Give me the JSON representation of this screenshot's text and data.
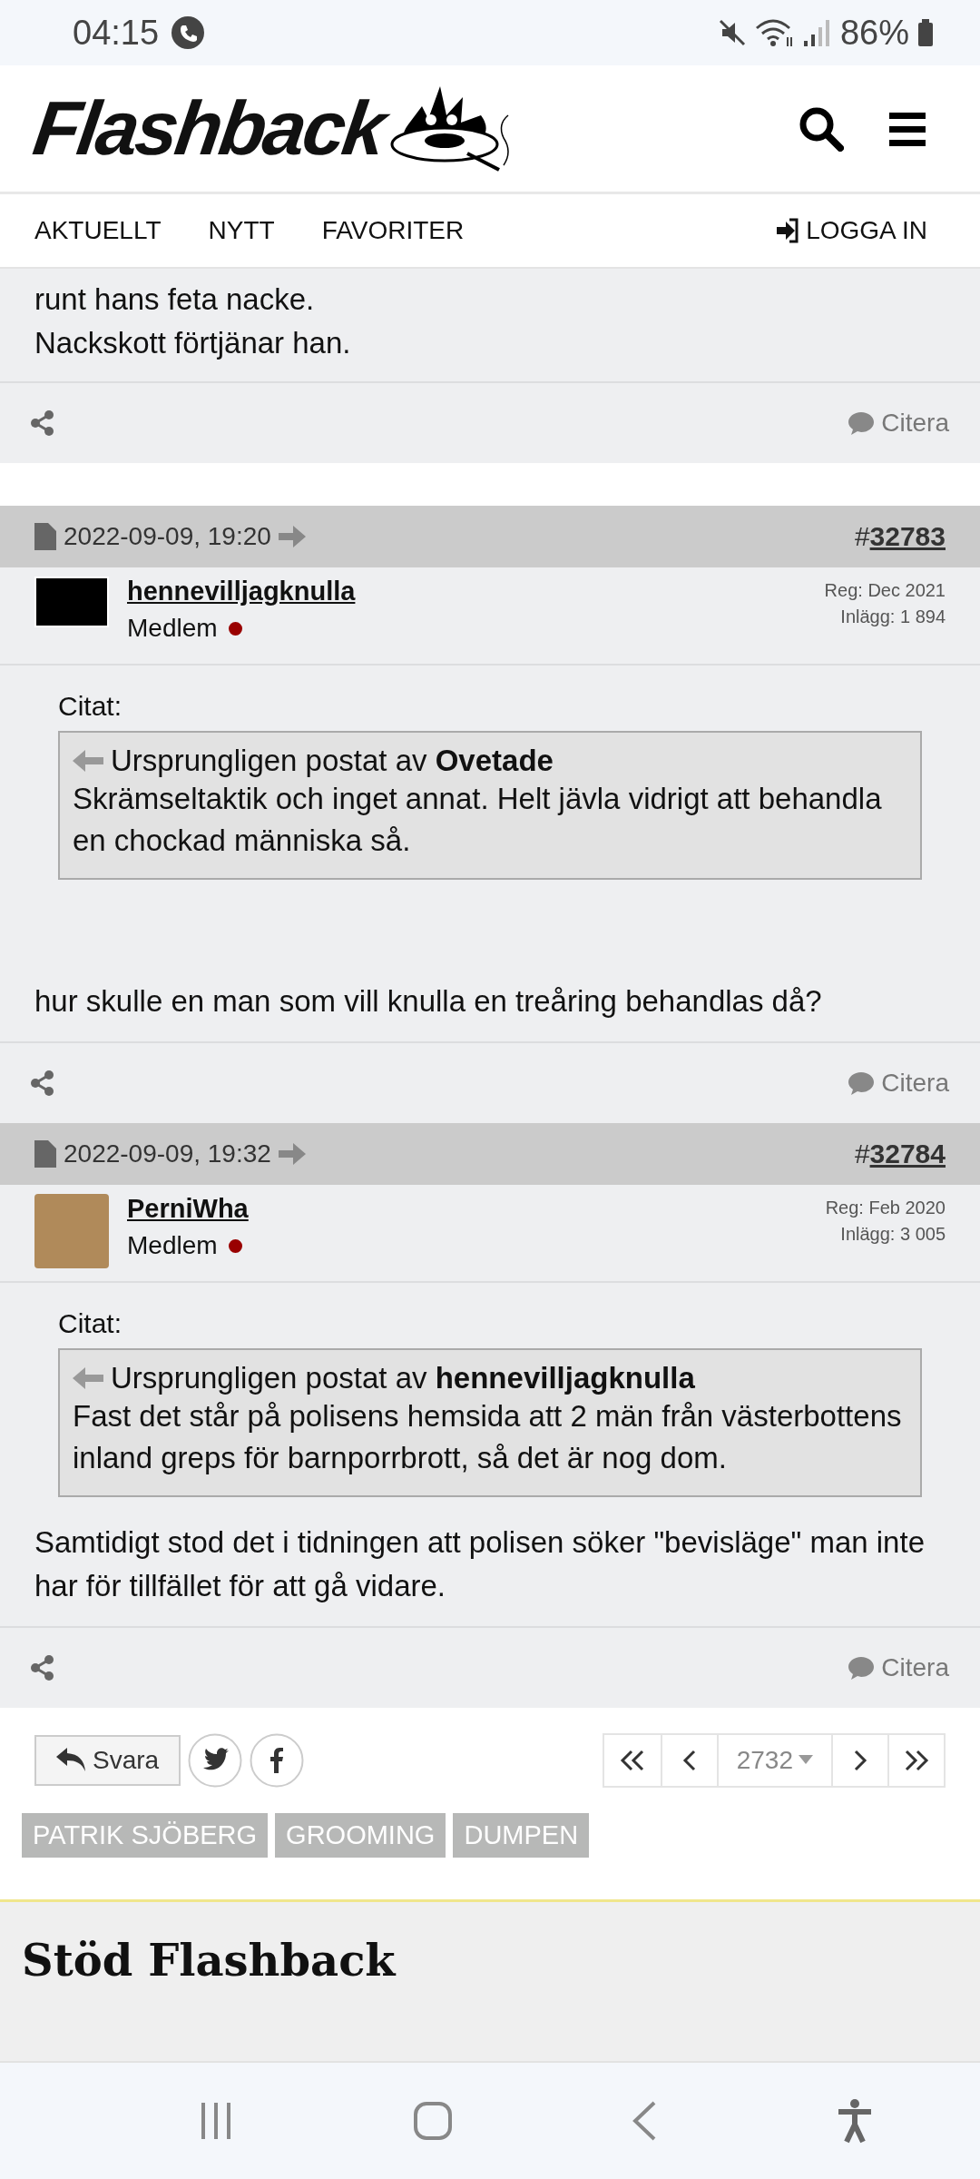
{
  "status_bar": {
    "time": "04:15",
    "battery": "86%"
  },
  "header": {
    "logo": "Flashback"
  },
  "nav": {
    "tabs": [
      {
        "label": "AKTUELLT"
      },
      {
        "label": "NYTT"
      },
      {
        "label": "FAVORITER"
      }
    ],
    "login": "LOGGA IN"
  },
  "posts": [
    {
      "kind": "partial",
      "body": [
        "runt hans feta nacke.",
        "Nackskott förtjänar han."
      ],
      "quote_action": "Citera"
    },
    {
      "kind": "full",
      "date": "2022-09-09, 19:20",
      "number_prefix": "#",
      "number": "32783",
      "user": {
        "name": "hennevilljagknulla",
        "rank": "Medlem",
        "online": false,
        "reg": "Reg: Dec 2021",
        "posts": "Inlägg: 1 894"
      },
      "quote": {
        "label": "Citat:",
        "intro": "Ursprungligen postat av **Ovetade**",
        "text": "Skrämseltaktik och inget annat. Helt jävla vidrigt att behandla en chockad människa så."
      },
      "body": [
        "hur skulle en man som vill knulla en treåring behandlas då?"
      ],
      "quote_action": "Citera"
    },
    {
      "kind": "full",
      "date": "2022-09-09, 19:32",
      "number_prefix": "#",
      "number": "32784",
      "user": {
        "name": "PerniWha",
        "rank": "Medlem",
        "online": false,
        "reg": "Reg: Feb 2020",
        "posts": "Inlägg: 3 005"
      },
      "quote": {
        "label": "Citat:",
        "intro": "Ursprungligen postat av **hennevilljagknulla**",
        "text": "Fast det står på polisens hemsida att 2 män från västerbottens inland greps för barnporrbrott, så det är nog dom."
      },
      "body": [
        "Samtidigt stod det i tidningen att polisen söker \"bevisläge\" man inte har för tillfället för att gå vidare."
      ],
      "quote_action": "Citera"
    }
  ],
  "reply_button": "Svara",
  "pagination": {
    "page": "2732"
  },
  "tags": [
    "PATRIK SJÖBERG",
    "GROOMING",
    "DUMPEN"
  ],
  "support": {
    "heading": "Stöd Flashback"
  }
}
